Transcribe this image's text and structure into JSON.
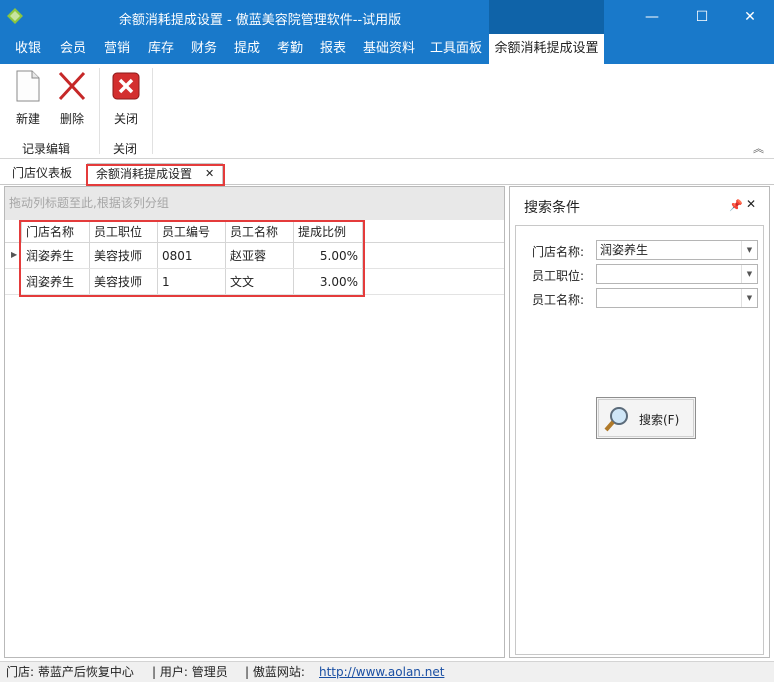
{
  "window": {
    "title": "余额消耗提成设置 - 傲蓝美容院管理软件--试用版",
    "min_icon": "minimize-icon",
    "max_icon": "maximize-icon",
    "close_icon": "close-icon"
  },
  "menu": {
    "items": [
      "收银",
      "会员",
      "营销",
      "库存",
      "财务",
      "提成",
      "考勤",
      "报表",
      "基础资料",
      "工具面板",
      "余额消耗提成设置"
    ],
    "active": "余额消耗提成设置"
  },
  "ribbon": {
    "buttons": [
      {
        "label": "新建",
        "icon": "new-document-icon"
      },
      {
        "label": "删除",
        "icon": "delete-x-icon"
      },
      {
        "label": "关闭",
        "icon": "close-red-icon"
      }
    ],
    "groups": [
      "记录编辑",
      "关闭"
    ],
    "collapse_glyph": "︽"
  },
  "doc_tabs": [
    {
      "label": "门店仪表板"
    },
    {
      "label": "余额消耗提成设置",
      "close": "✕"
    }
  ],
  "grid": {
    "group_hint": "拖动列标题至此,根据该列分组",
    "columns": [
      "门店名称",
      "员工职位",
      "员工编号",
      "员工名称",
      "提成比例"
    ],
    "rows": [
      [
        "润姿养生",
        "美容技师",
        "0801",
        "赵亚蓉",
        "5.00%"
      ],
      [
        "润姿养生",
        "美容技师",
        "1",
        "文文",
        "3.00%"
      ]
    ]
  },
  "search": {
    "title": "搜索条件",
    "fields": [
      {
        "label": "门店名称:",
        "value": "润姿养生"
      },
      {
        "label": "员工职位:",
        "value": ""
      },
      {
        "label": "员工名称:",
        "value": ""
      }
    ],
    "button": "搜索(F)"
  },
  "status": {
    "store": "门店: 蒂蓝产后恢复中心",
    "user": "| 用户: 管理员",
    "site_label": "| 傲蓝网站:",
    "site_url": "http://www.aolan.net"
  },
  "colors": {
    "titlebar": "#1979ca",
    "highlight": "#e43b3b"
  }
}
